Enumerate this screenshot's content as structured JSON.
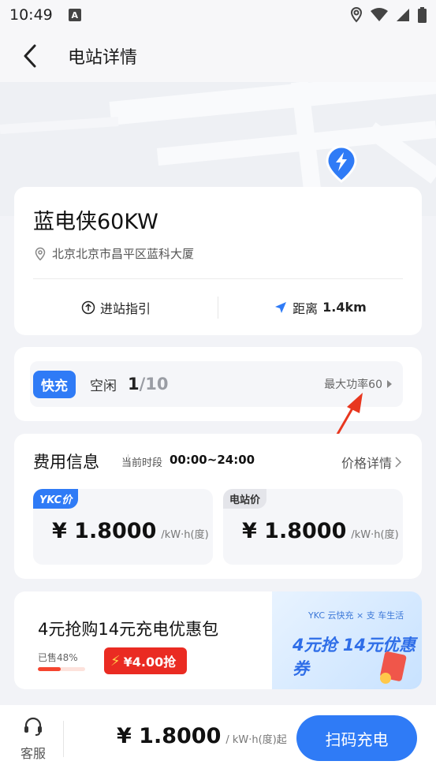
{
  "status_bar": {
    "time": "10:49",
    "notification_icon": "a-icon",
    "icons": [
      "location-icon",
      "wifi-icon",
      "signal-icon",
      "battery-icon"
    ]
  },
  "header": {
    "title": "电站详情"
  },
  "station": {
    "name": "蓝电侠60KW",
    "address": "北京北京市昌平区蓝科大厦",
    "guide_label": "进站指引",
    "distance_label": "距离",
    "distance_value": "1.4km"
  },
  "charging": {
    "tag": "快充",
    "status": "空闲",
    "available": "1",
    "total": "/10",
    "max_power": "最大功率60"
  },
  "fee": {
    "title": "费用信息",
    "period_label": "当前时段",
    "period": "00:00~24:00",
    "detail_link": "价格详情",
    "ykc": {
      "tag": "YKC价",
      "price": "¥ 1.8000",
      "unit": "/kW·h(度)"
    },
    "station": {
      "tag": "电站价",
      "price": "¥ 1.8000",
      "unit": "/kW·h(度)"
    }
  },
  "promo": {
    "title": "4元抢购14元充电优惠包",
    "sold_text": "已售48%",
    "sold_fraction": 0.48,
    "buy_label": "¥4.00抢",
    "banner_brand": "YKC 云快充 × 支 车生活",
    "banner_text": "4元抢 14元优惠券"
  },
  "bottom": {
    "service_label": "客服",
    "price": "¥ 1.8000",
    "unit": "/ kW·h(度)起",
    "scan_button": "扫码充电"
  },
  "colors": {
    "primary": "#2f7bf6",
    "danger": "#ea2b22",
    "arrow": "#e8371f"
  }
}
